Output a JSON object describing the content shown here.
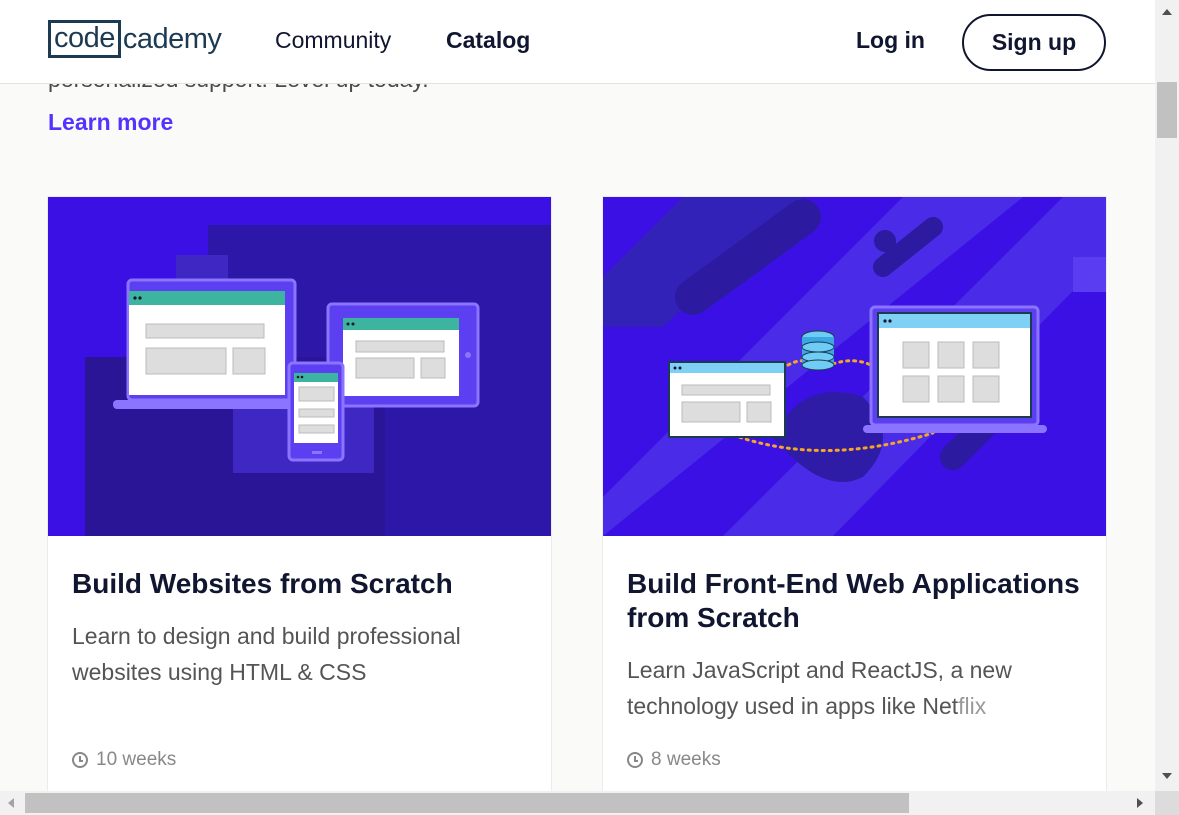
{
  "header": {
    "logo_boxed": "code",
    "logo_rest": "cademy",
    "nav": [
      {
        "label": "Community"
      },
      {
        "label": "Catalog"
      }
    ],
    "login_label": "Log in",
    "signup_label": "Sign up"
  },
  "promo": {
    "cut_text": "personalized support. Level up today.",
    "learn_more_label": "Learn more"
  },
  "cards": [
    {
      "title": "Build Websites from Scratch",
      "description": "Learn to design and build professional websites using HTML & CSS",
      "description_faded": "",
      "duration": "10 weeks"
    },
    {
      "title": "Build Front-End Web Applications from Scratch",
      "description": "Learn JavaScript and ReactJS, a new technology used in apps like Net",
      "description_faded": "flix",
      "duration": "8 weeks"
    }
  ],
  "colors": {
    "accent": "#5533ff",
    "navy": "#10162f",
    "card_bg": "#3a10e5"
  }
}
